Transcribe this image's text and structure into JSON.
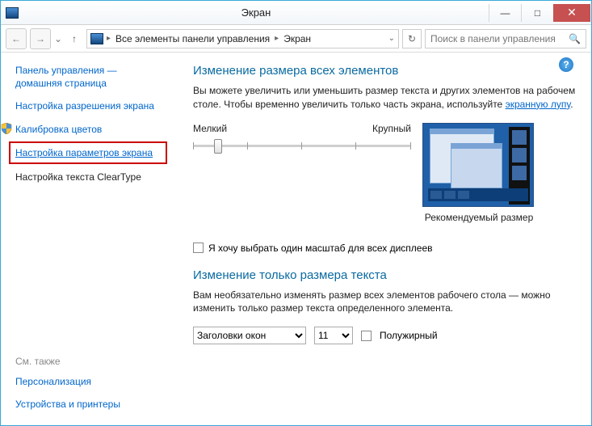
{
  "window": {
    "title": "Экран"
  },
  "winctrl": {
    "min": "—",
    "max": "□",
    "close": "✕"
  },
  "nav": {
    "back": "←",
    "fwd": "→",
    "up": "↑",
    "reload": "↻",
    "dropdown": "⌄"
  },
  "breadcrumb": {
    "root_icon": "cp",
    "seg1": "Все элементы панели управления",
    "seg2": "Экран"
  },
  "search": {
    "placeholder": "Поиск в панели управления",
    "icon": "🔍"
  },
  "sidebar": {
    "home": "Панель управления — домашняя страница",
    "items": [
      {
        "label": "Настройка разрешения экрана"
      },
      {
        "label": "Калибровка цветов",
        "shield": true
      },
      {
        "label": "Настройка параметров экрана",
        "highlight": true
      },
      {
        "label": "Настройка текста ClearType"
      }
    ],
    "seealso_hdr": "См. также",
    "seealso": [
      {
        "label": "Персонализация"
      },
      {
        "label": "Устройства и принтеры"
      }
    ]
  },
  "main": {
    "h1": "Изменение размера всех элементов",
    "desc_pre": "Вы можете увеличить или уменьшить размер текста и других элементов на рабочем столе. Чтобы временно увеличить только часть экрана, используйте ",
    "desc_link": "экранную лупу",
    "desc_post": ".",
    "slider": {
      "min_label": "Мелкий",
      "max_label": "Крупный"
    },
    "preview_caption": "Рекомендуемый размер",
    "chk_label": "Я хочу выбрать один масштаб для всех дисплеев",
    "h2": "Изменение только размера текста",
    "desc2": "Вам необязательно изменять размер всех элементов рабочего стола — можно изменить только размер текста определенного элемента.",
    "select_element": {
      "options": [
        "Заголовки окон"
      ],
      "value": "Заголовки окон"
    },
    "select_size": {
      "options": [
        "11"
      ],
      "value": "11"
    },
    "bold_label": "Полужирный"
  },
  "help": "?"
}
